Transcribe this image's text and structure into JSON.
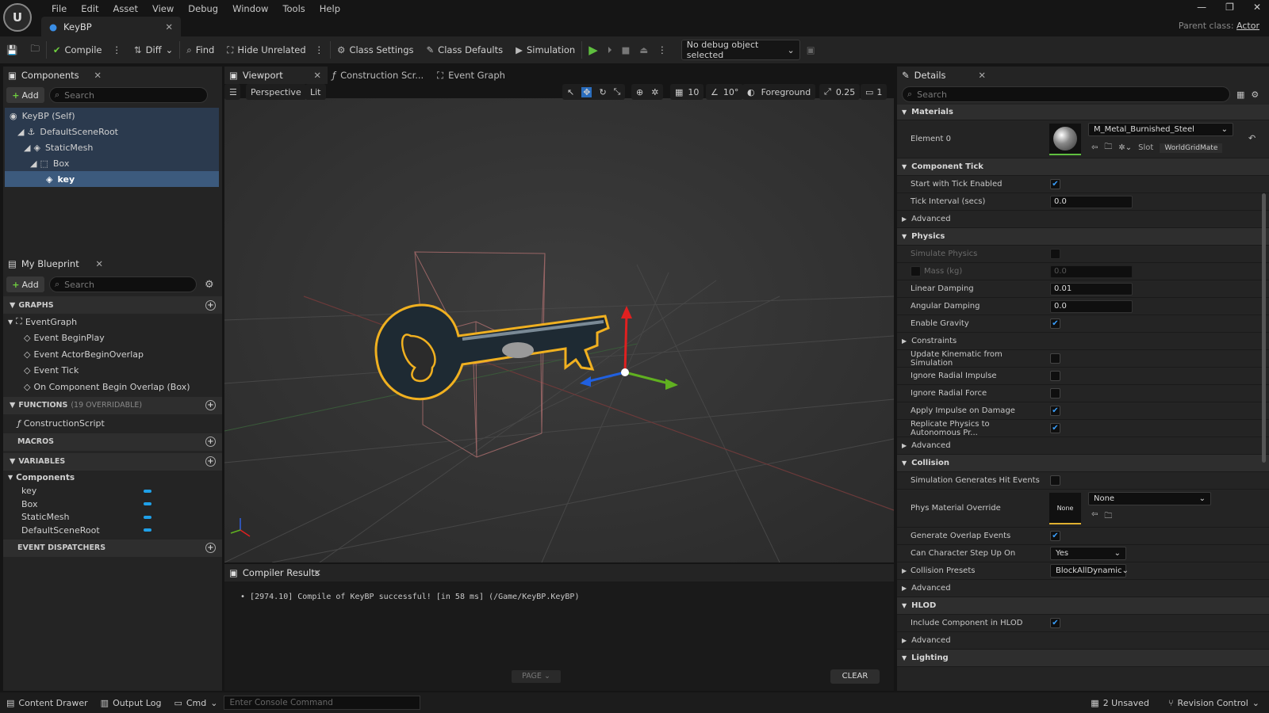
{
  "titlebar": {
    "menu": [
      "File",
      "Edit",
      "Asset",
      "View",
      "Debug",
      "Window",
      "Tools",
      "Help"
    ],
    "doc_tab": "KeyBP",
    "parent_label": "Parent class:",
    "parent_value": "Actor"
  },
  "toolbar": {
    "compile": "Compile",
    "diff": "Diff",
    "find": "Find",
    "hide_unrelated": "Hide Unrelated",
    "class_settings": "Class Settings",
    "class_defaults": "Class Defaults",
    "simulation": "Simulation",
    "debug_object": "No debug object selected"
  },
  "components": {
    "tab": "Components",
    "add": "Add",
    "search_placeholder": "Search",
    "tree": [
      {
        "label": "KeyBP (Self)",
        "indent": 0
      },
      {
        "label": "DefaultSceneRoot",
        "indent": 1
      },
      {
        "label": "StaticMesh",
        "indent": 2
      },
      {
        "label": "Box",
        "indent": 3
      },
      {
        "label": "key",
        "indent": 4
      }
    ]
  },
  "my_blueprint": {
    "tab": "My Blueprint",
    "add": "Add",
    "search_placeholder": "Search",
    "graphs_header": "GRAPHS",
    "event_graph": "EventGraph",
    "events": [
      "Event BeginPlay",
      "Event ActorBeginOverlap",
      "Event Tick",
      "On Component Begin Overlap (Box)"
    ],
    "functions_header": "FUNCTIONS",
    "functions_note": "(19 OVERRIDABLE)",
    "construction_script": "ConstructionScript",
    "macros_header": "MACROS",
    "variables_header": "VARIABLES",
    "components_group": "Components",
    "variables": [
      "key",
      "Box",
      "StaticMesh",
      "DefaultSceneRoot"
    ],
    "dispatchers_header": "EVENT DISPATCHERS"
  },
  "editor_tabs": [
    "Viewport",
    "Construction Scr...",
    "Event Graph"
  ],
  "viewport": {
    "perspective": "Perspective",
    "lit": "Lit",
    "grid": "10",
    "angle": "10°",
    "foreground": "Foreground",
    "scale": "0.25",
    "camera": "1"
  },
  "compiler": {
    "tab": "Compiler Results",
    "message": "[2974.10] Compile of KeyBP successful! [in 58 ms] (/Game/KeyBP.KeyBP)",
    "page": "PAGE",
    "clear": "CLEAR"
  },
  "details": {
    "tab": "Details",
    "search_placeholder": "Search",
    "materials": "Materials",
    "element0": "Element 0",
    "material_name": "M_Metal_Burnished_Steel",
    "slot_label": "Slot",
    "slot_value": "WorldGridMate",
    "component_tick": "Component Tick",
    "start_tick": "Start with Tick Enabled",
    "tick_interval": "Tick Interval (secs)",
    "tick_interval_value": "0.0",
    "advanced": "Advanced",
    "physics": "Physics",
    "simulate_physics": "Simulate Physics",
    "mass": "Mass (kg)",
    "mass_value": "0.0",
    "linear_damping": "Linear Damping",
    "linear_damping_value": "0.01",
    "angular_damping": "Angular Damping",
    "angular_damping_value": "0.0",
    "enable_gravity": "Enable Gravity",
    "constraints": "Constraints",
    "update_kinematic": "Update Kinematic from Simulation",
    "ignore_radial_impulse": "Ignore Radial Impulse",
    "ignore_radial_force": "Ignore Radial Force",
    "apply_impulse": "Apply Impulse on Damage",
    "replicate_physics": "Replicate Physics to Autonomous Pr...",
    "collision": "Collision",
    "sim_hit_events": "Simulation Generates Hit Events",
    "phys_material": "Phys Material Override",
    "phys_material_thumb": "None",
    "phys_material_value": "None",
    "overlap_events": "Generate Overlap Events",
    "step_up": "Can Character Step Up On",
    "step_up_value": "Yes",
    "collision_presets": "Collision Presets",
    "collision_presets_value": "BlockAllDynamic",
    "hlod": "HLOD",
    "include_hlod": "Include Component in HLOD",
    "lighting": "Lighting"
  },
  "statusbar": {
    "content_drawer": "Content Drawer",
    "output_log": "Output Log",
    "cmd": "Cmd",
    "console_placeholder": "Enter Console Command",
    "unsaved": "2 Unsaved",
    "revision_control": "Revision Control"
  }
}
